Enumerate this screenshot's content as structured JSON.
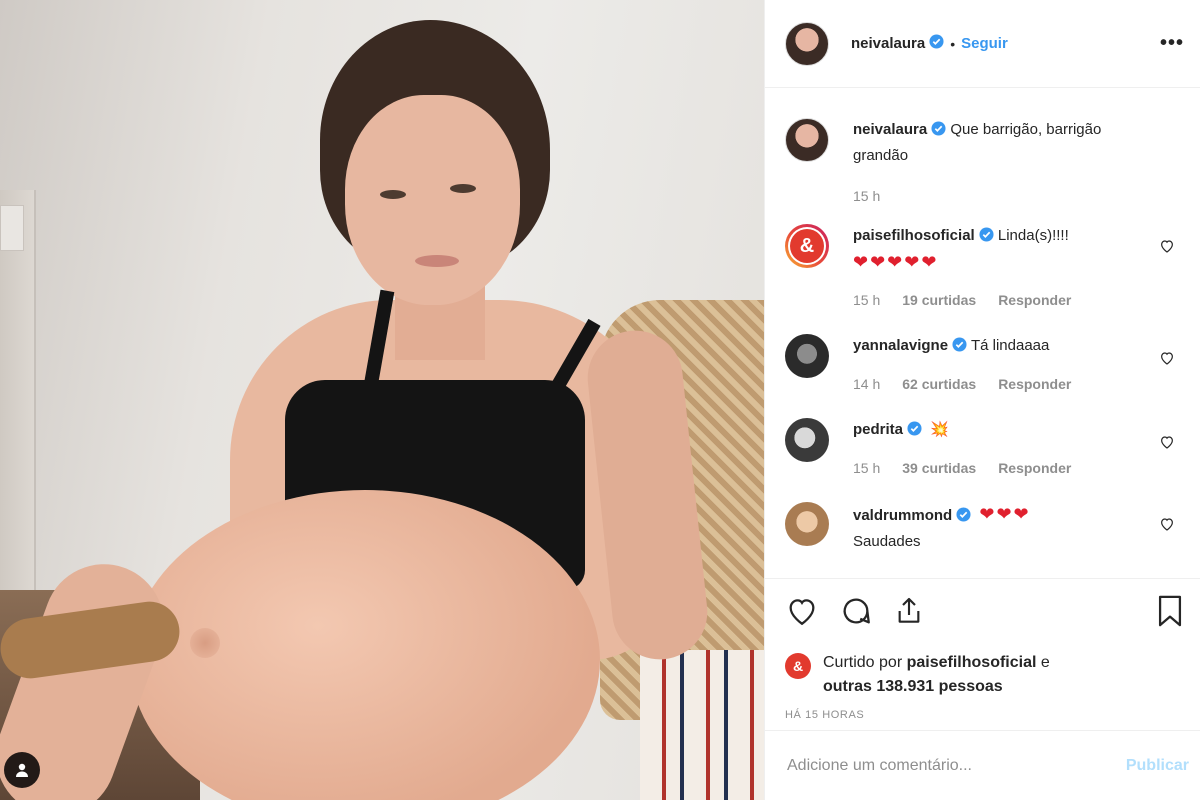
{
  "post": {
    "author": "neivalaura",
    "follow_label": "Seguir",
    "separator": "•",
    "more_label": "•••"
  },
  "caption": {
    "username": "neivalaura",
    "text": "Que barrigão, barrigão grandão",
    "time": "15 h"
  },
  "comments": [
    {
      "username": "paisefilhosoficial",
      "text": "Linda(s)!!!!",
      "emoji": "❤❤❤❤❤",
      "time": "15 h",
      "likes": "19 curtidas",
      "reply": "Responder",
      "avatar_text": "&"
    },
    {
      "username": "yannalavigne",
      "text": "Tá lindaaaa",
      "time": "14 h",
      "likes": "62 curtidas",
      "reply": "Responder"
    },
    {
      "username": "pedrita",
      "text": "",
      "emoji": "💥",
      "time": "15 h",
      "likes": "39 curtidas",
      "reply": "Responder"
    },
    {
      "username": "valdrummond",
      "emoji": "❤❤❤",
      "text": "Saudades"
    }
  ],
  "likes": {
    "prefix": "Curtido por",
    "liker": "paisefilhosoficial",
    "connector": "e",
    "others": "outras 138.931 pessoas",
    "avatar_text": "&"
  },
  "timestamp": "HÁ 15 HORAS",
  "comment_box": {
    "placeholder": "Adicione um comentário...",
    "publish_label": "Publicar"
  },
  "colors": {
    "link_blue": "#3897f0",
    "verified_blue": "#3897f0",
    "heart_red": "#ed4956",
    "publish_disabled": "#b2dffc"
  },
  "icons": [
    "heart-icon",
    "comment-icon",
    "share-icon",
    "bookmark-icon",
    "verified-icon",
    "user-tag-icon",
    "more-icon"
  ]
}
